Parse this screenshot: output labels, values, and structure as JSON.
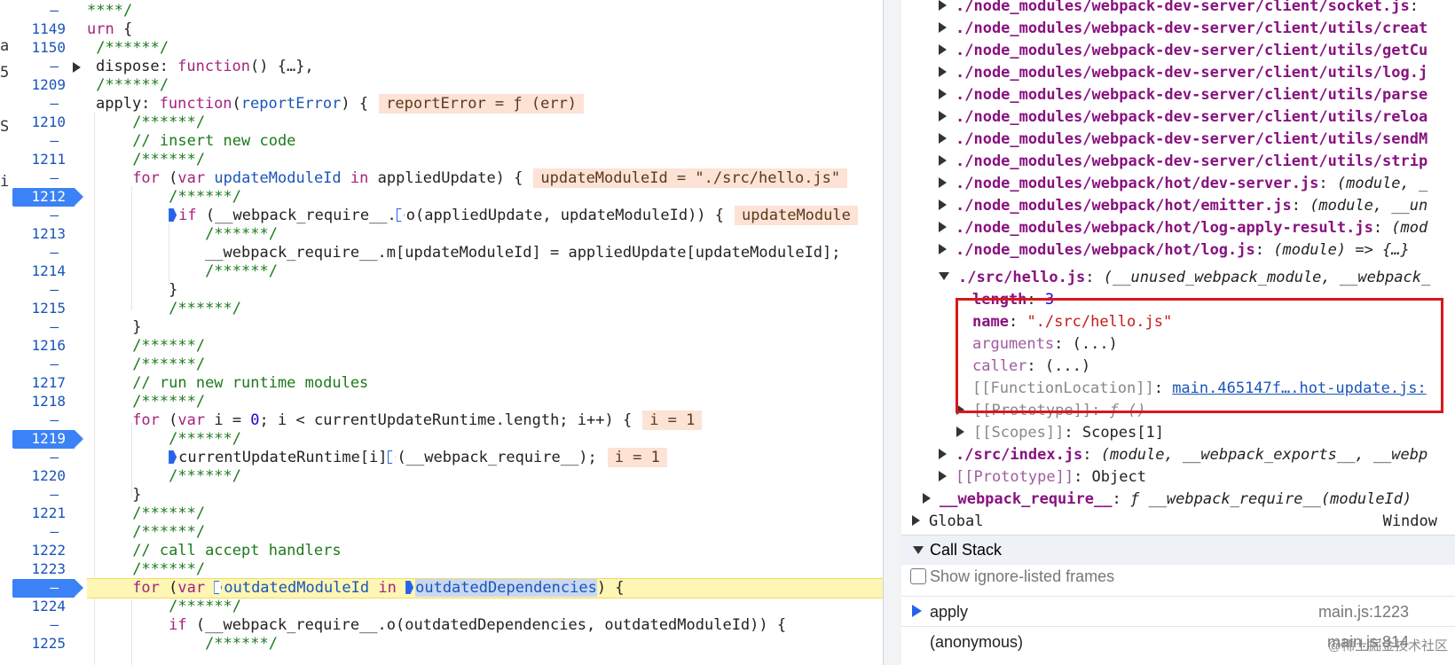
{
  "left_strip": [
    "a",
    "5",
    "S",
    "i"
  ],
  "line_numbers": [
    "",
    "1149",
    "1150",
    "",
    "1209",
    "",
    "1210",
    "",
    "1211",
    "",
    "1212",
    "",
    "1213",
    "",
    "1214",
    "",
    "1215",
    "",
    "1216",
    "",
    "1217",
    "1218",
    "",
    "1219",
    "",
    "1220",
    "",
    "1221",
    "",
    "1222",
    "1223",
    "",
    "1224",
    "",
    "1225"
  ],
  "inline_values": {
    "report_error": "reportError = ƒ (err)",
    "update_module_id": "updateModuleId = \"./src/hello.js\"",
    "update_module_cut": "updateModule",
    "i1": "i = 1",
    "i2": "i = 1"
  },
  "code": {
    "l0": "****/",
    "l1_kw": "urn",
    "l1_rest": " {",
    "c6": "/******/",
    "dispose_key": "dispose: ",
    "dispose_fn": "function",
    "dispose_rest": "() {…},",
    "apply_key": "apply: ",
    "apply_fn": "function",
    "apply_param": "reportError",
    "apply_rest": ") {",
    "comment_insert": "// insert new code",
    "for_kw": "for",
    "var_kw": "var",
    "in_kw": "in",
    "update_module_id": "updateModuleId",
    "applied_update_rest": " appliedUpdate) {",
    "if_kw": "if",
    "wr_o_prefix": " (__webpack_require__.",
    "o_call": "o",
    "wr_o_args": "(appliedUpdate, updateModuleId)) {",
    "assign_line": "__webpack_require__.m[updateModuleId] = appliedUpdate[updateModuleId];",
    "close_brace": "}",
    "comment_run": "// run new runtime modules",
    "i_decl": " i = ",
    "zero": "0",
    "loop_rest": "; i < currentUpdateRuntime.length; i++) {",
    "call_runtime_a": "currentUpdateRuntime[i]",
    "call_runtime_b": "(__webpack_require__);",
    "comment_accept": "// call accept handlers",
    "outdated_id": "outdatedModuleId",
    "outdated_deps": "outdatedDependencies",
    "close_paren_brace": ") {",
    "if_outdated": " (__webpack_require__.o(outdatedDependencies, outdatedModuleId)) {",
    "open_paren": "(",
    "space": " "
  },
  "tree": {
    "modules": [
      {
        "path": "./node_modules/webpack-dev-server/client/socket.js",
        "rest": ":"
      },
      {
        "path": "./node_modules/webpack-dev-server/client/utils/creat",
        "rest": ""
      },
      {
        "path": "./node_modules/webpack-dev-server/client/utils/getCu",
        "rest": ""
      },
      {
        "path": "./node_modules/webpack-dev-server/client/utils/log.j",
        "rest": ""
      },
      {
        "path": "./node_modules/webpack-dev-server/client/utils/parse",
        "rest": ""
      },
      {
        "path": "./node_modules/webpack-dev-server/client/utils/reloa",
        "rest": ""
      },
      {
        "path": "./node_modules/webpack-dev-server/client/utils/sendM",
        "rest": ""
      },
      {
        "path": "./node_modules/webpack-dev-server/client/utils/strip",
        "rest": ""
      },
      {
        "path": "./node_modules/webpack/hot/dev-server.js",
        "rest": "(module, _"
      },
      {
        "path": "./node_modules/webpack/hot/emitter.js",
        "rest": "(module, __un"
      },
      {
        "path": "./node_modules/webpack/hot/log-apply-result.js",
        "rest": "(mod"
      },
      {
        "path": "./node_modules/webpack/hot/log.js",
        "rest": "(module) => {…}"
      }
    ],
    "hello": {
      "path": "./src/hello.js",
      "rest": "(__unused_webpack_module, __webpack_"
    },
    "props": {
      "length_key": "length",
      "length_val": "3",
      "name_key": "name",
      "name_val": "\"./src/hello.js\"",
      "arguments_key": "arguments",
      "arguments_val": "(...)",
      "caller_key": "caller",
      "caller_val": "(...)",
      "fl_key": "[[FunctionLocation]]",
      "fl_val": "main.465147f….hot-update.js:",
      "proto_key": "[[Prototype]]",
      "proto_val": "ƒ ()",
      "scopes_key": "[[Scopes]]",
      "scopes_val": "Scopes[1]"
    },
    "index": {
      "path": "./src/index.js",
      "rest": "(module, __webpack_exports__, __webp"
    },
    "proto_obj": {
      "key": "[[Prototype]]",
      "val": "Object"
    },
    "wr": {
      "key": "__webpack_require__",
      "f": "ƒ",
      "val": "__webpack_require__(moduleId)"
    },
    "global": {
      "label": "Global",
      "value": "Window"
    }
  },
  "call_stack": {
    "title": "Call Stack",
    "show_ignore": "Show ignore-listed frames",
    "frames": [
      {
        "name": "apply",
        "loc": "main.js:1223"
      },
      {
        "name": "(anonymous)",
        "loc": "main.js:814"
      }
    ]
  },
  "watermark": "@稀土掘金技术社区",
  "colors": {
    "breakpoint": "#3b82f6",
    "current_line": "#fdf6b5",
    "highlight_box": "#d7191c"
  }
}
